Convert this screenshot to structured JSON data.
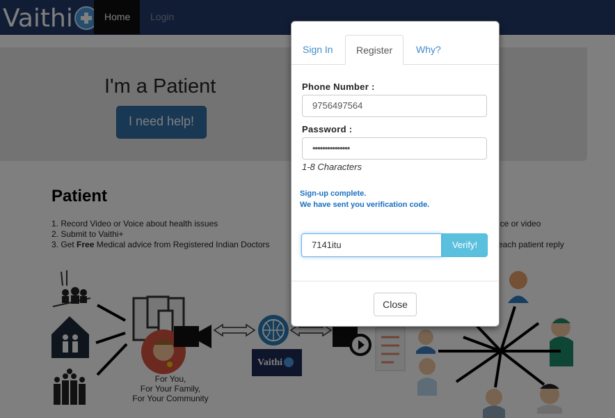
{
  "nav": {
    "brand": "Vaithi",
    "home": "Home",
    "login": "Login"
  },
  "hero": {
    "title": "I'm a Patient",
    "button": "I need help!"
  },
  "patient": {
    "title": "Patient",
    "step1": "1. Record Video or Voice about health issues",
    "step2": "2. Submit to Vaithi+",
    "step3_prefix": "3. Get ",
    "step3_bold": "Free",
    "step3_suffix": " Medical advice from Registered Indian Doctors",
    "right_line1": "ice or video",
    "right_line2": "each patient reply",
    "caption_line1": "For You,",
    "caption_line2": "For Your Family,",
    "caption_line3": "For Your Community",
    "logo_small": "Vaithi"
  },
  "modal": {
    "tabs": [
      "Sign In",
      "Register",
      "Why?"
    ],
    "phone_label": "Phone Number :",
    "phone_value": "9756497564",
    "password_label": "Password :",
    "password_value": "•••••••••••••••",
    "password_hint": "1-8 Characters",
    "notice_line1": "Sign-up complete.",
    "notice_line2": "We have sent you verification code.",
    "code_value": "7141itu",
    "verify_button": "Verify!",
    "close_button": "Close"
  },
  "colors": {
    "navbar": "#223a6b",
    "primary": "#3071a9",
    "info": "#5bc0de",
    "notice": "#1a6fc1"
  }
}
